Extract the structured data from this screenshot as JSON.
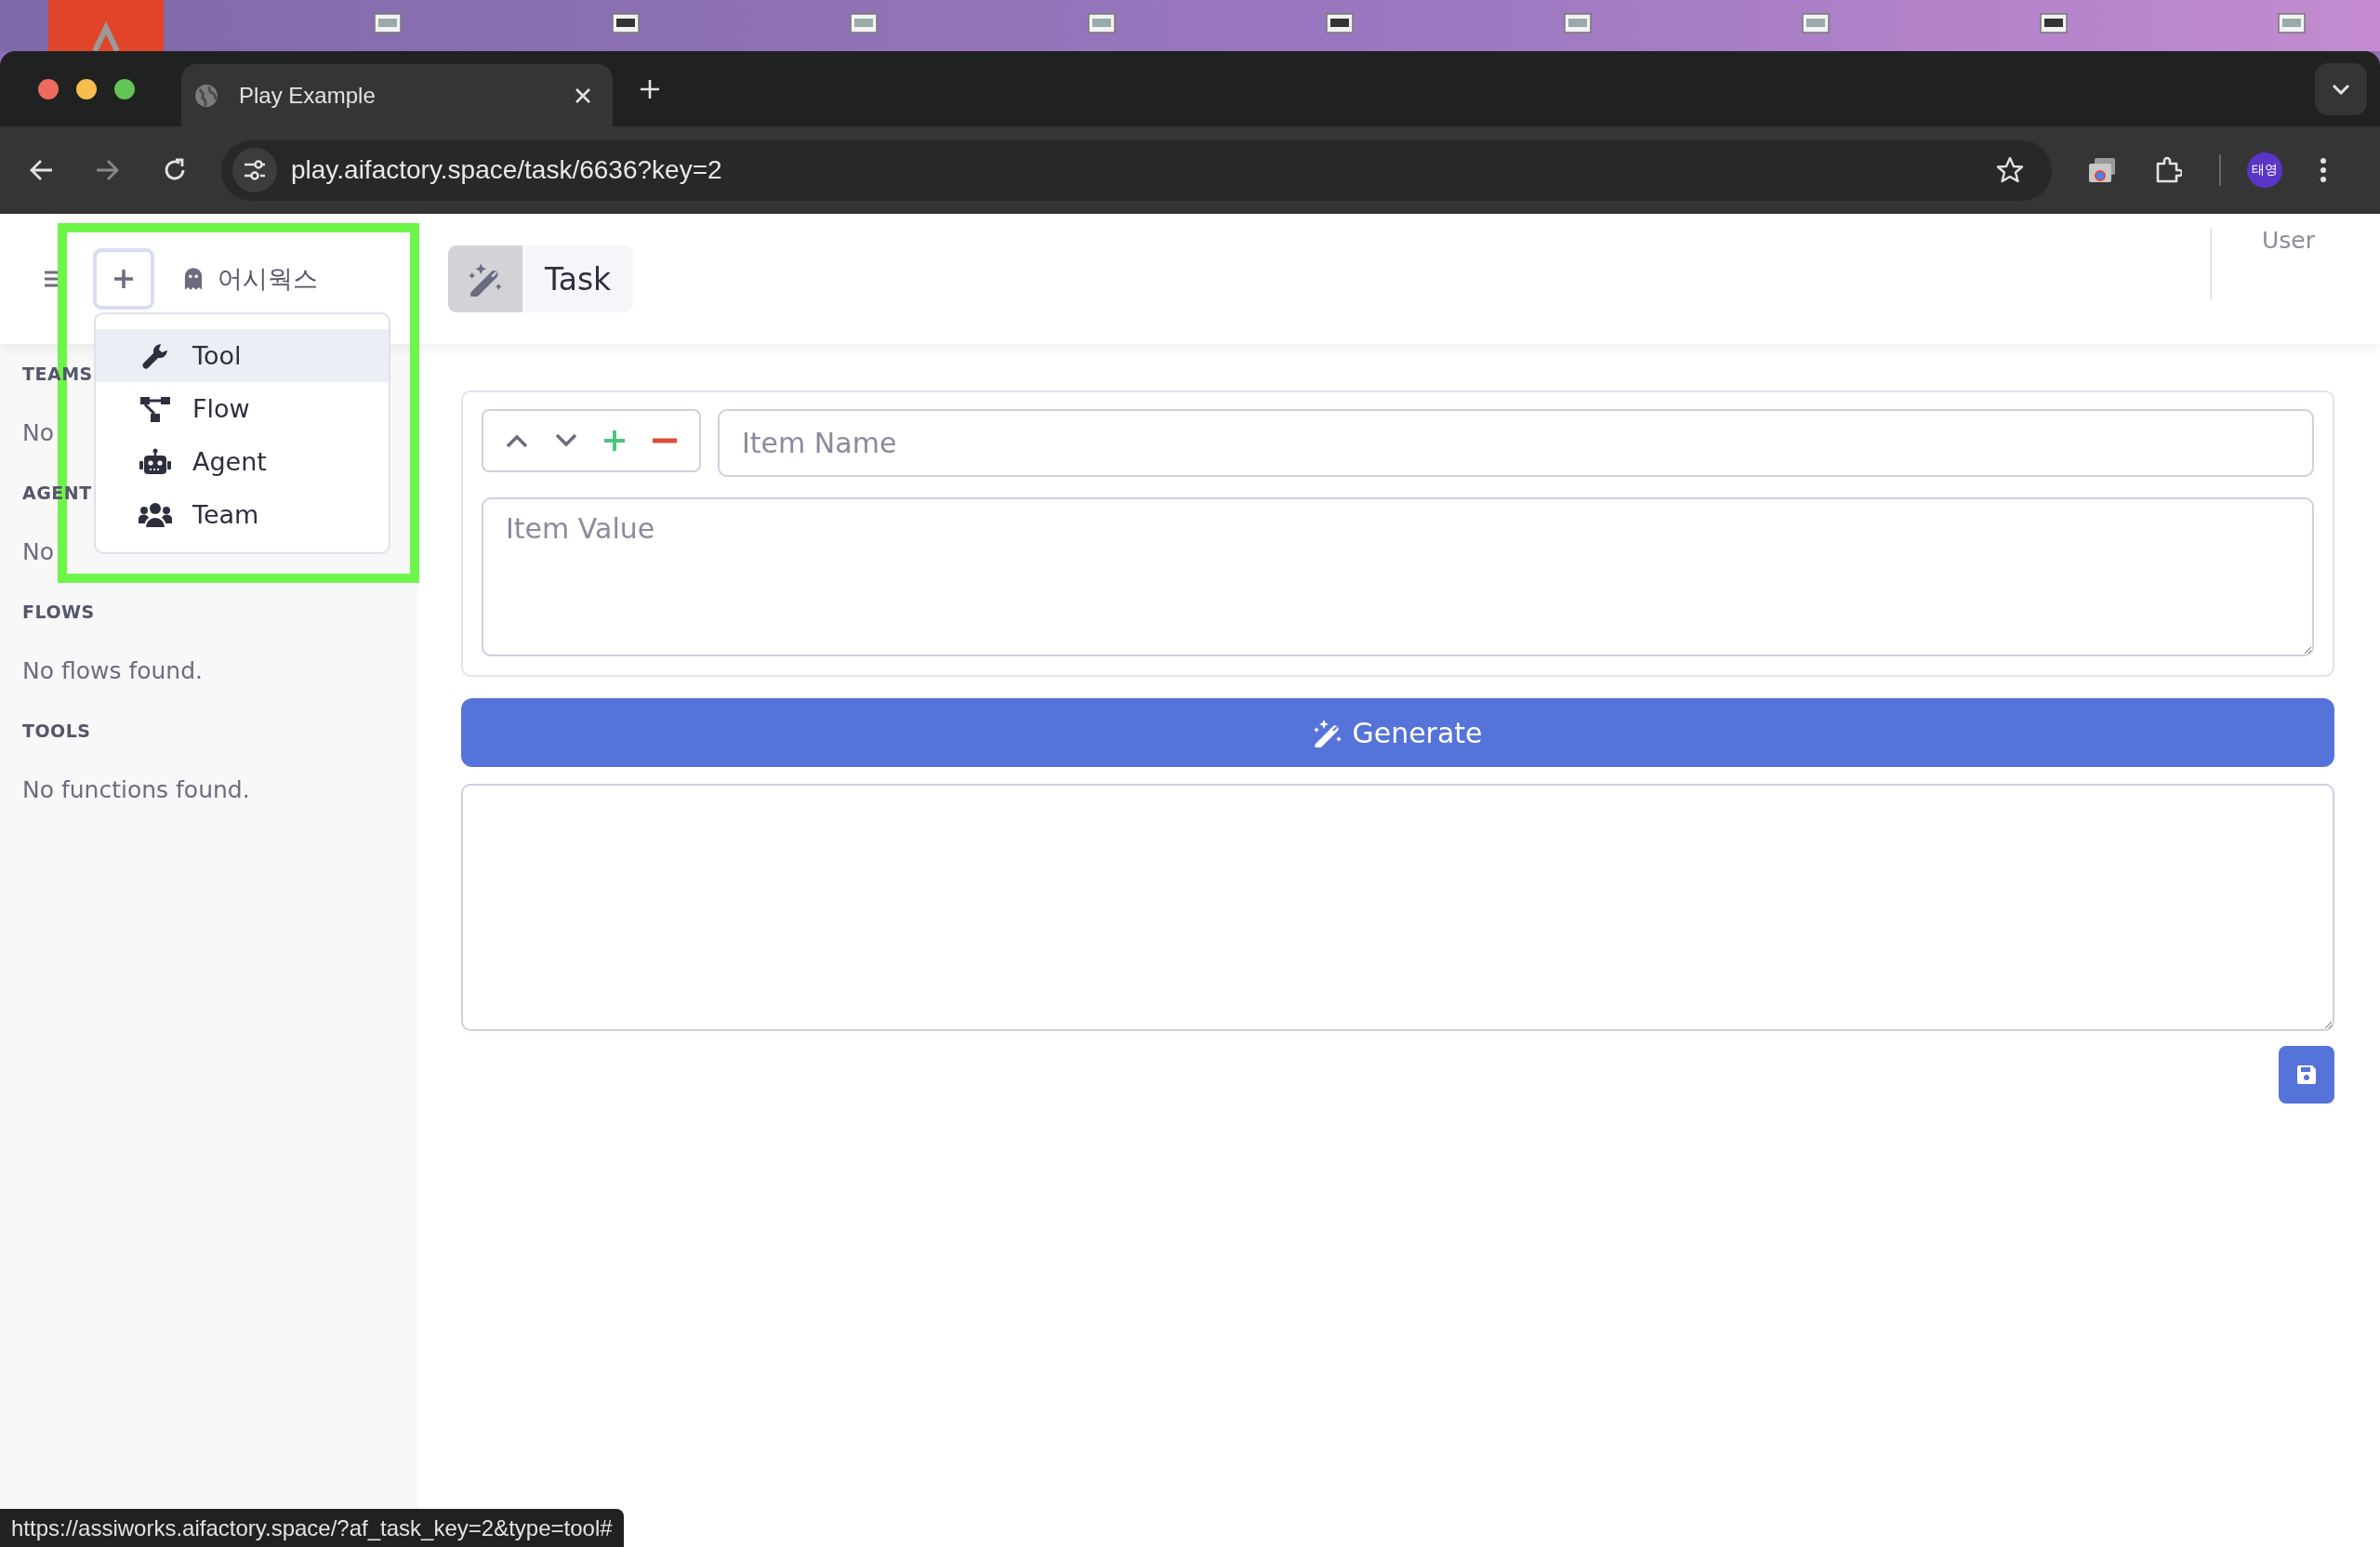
{
  "browser": {
    "tabs": [
      {
        "title": "Play Example",
        "selected": true
      }
    ],
    "address": "play.aifactory.space/task/6636?key=2",
    "profile": "태영"
  },
  "header": {
    "workspace": "어시웍스",
    "page_title": "Task",
    "user": "User"
  },
  "add_menu": {
    "open": true,
    "items": [
      {
        "label": "Tool",
        "kind": "tool",
        "highlighted": true
      },
      {
        "label": "Flow",
        "kind": "flow",
        "highlighted": false
      },
      {
        "label": "Agent",
        "kind": "agent",
        "highlighted": false
      },
      {
        "label": "Team",
        "kind": "team",
        "highlighted": false
      }
    ]
  },
  "sidebar": {
    "sections": [
      {
        "heading": "TEAMS",
        "empty_text": "No"
      },
      {
        "heading": "AGENT",
        "empty_text": "No"
      },
      {
        "heading": "FLOWS",
        "empty_text": "No flows found."
      },
      {
        "heading": "TOOLS",
        "empty_text": "No functions found."
      }
    ]
  },
  "item_editor": {
    "name_placeholder": "Item Name",
    "value_placeholder": "Item Value"
  },
  "generate_button": "Generate",
  "status_url": "https://assiworks.aifactory.space/?af_task_key=2&type=tool#"
}
